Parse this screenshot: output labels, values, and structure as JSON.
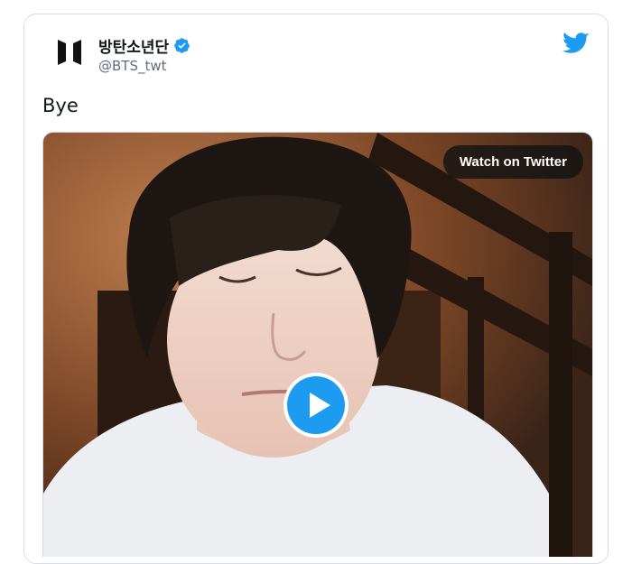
{
  "tweet": {
    "display_name": "방탄소년단",
    "handle": "@BTS_twt",
    "text": "Bye",
    "verified": true,
    "avatar_icon": "bts-logo-icon",
    "platform_icon": "twitter-bird-icon"
  },
  "media": {
    "watch_label": "Watch on Twitter",
    "play_icon": "play-icon"
  },
  "colors": {
    "twitter_blue": "#1d9bf0",
    "text_primary": "#14171a",
    "text_secondary": "#5b7083"
  }
}
